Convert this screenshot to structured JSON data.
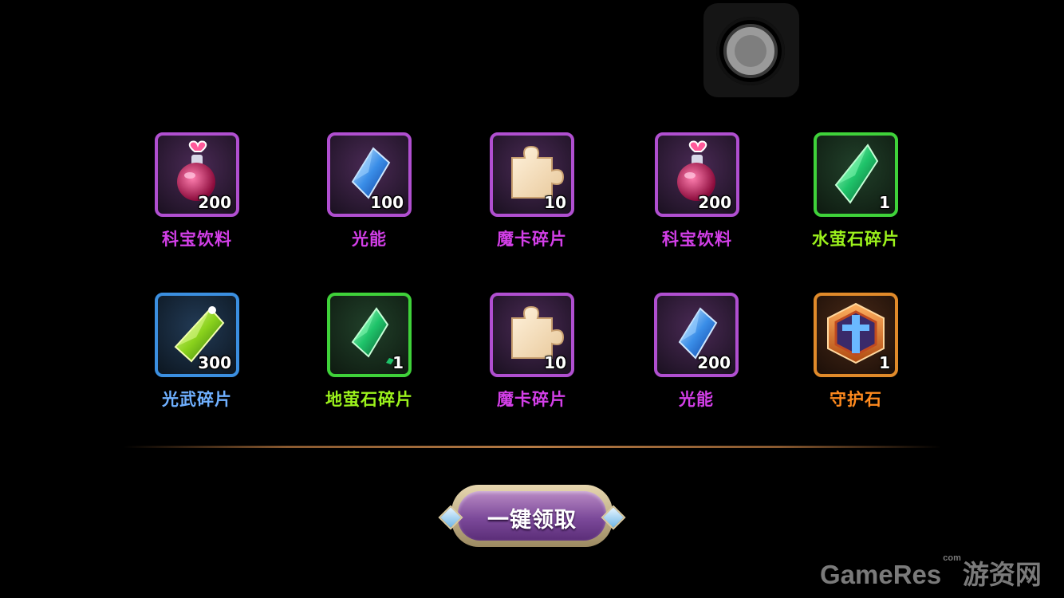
{
  "colors": {
    "purple": "#d33fe8",
    "blue": "#6fb0ff",
    "green": "#9cf21c",
    "orange": "#ff8a1e"
  },
  "rewards": [
    {
      "name": "科宝饮料",
      "qty": "200",
      "icon": "potion-icon",
      "rarity": "purple"
    },
    {
      "name": "光能",
      "qty": "100",
      "icon": "blue-crystal-icon",
      "rarity": "purple"
    },
    {
      "name": "魔卡碎片",
      "qty": "10",
      "icon": "puzzle-piece-icon",
      "rarity": "purple"
    },
    {
      "name": "科宝饮料",
      "qty": "200",
      "icon": "potion-icon",
      "rarity": "purple"
    },
    {
      "name": "水萤石碎片",
      "qty": "1",
      "icon": "green-crystal-icon",
      "rarity": "green"
    },
    {
      "name": "光武碎片",
      "qty": "300",
      "icon": "lime-crystal-icon",
      "rarity": "blue"
    },
    {
      "name": "地萤石碎片",
      "qty": "1",
      "icon": "green-crystal-shard-icon",
      "rarity": "green"
    },
    {
      "name": "魔卡碎片",
      "qty": "10",
      "icon": "puzzle-piece-icon",
      "rarity": "purple"
    },
    {
      "name": "光能",
      "qty": "200",
      "icon": "blue-crystal-icon",
      "rarity": "purple"
    },
    {
      "name": "守护石",
      "qty": "1",
      "icon": "guardian-stone-icon",
      "rarity": "orange"
    }
  ],
  "claim_button": {
    "label": "一键领取"
  },
  "watermark": {
    "brand": "GameRes",
    "com": "com",
    "cn": "游资网"
  }
}
